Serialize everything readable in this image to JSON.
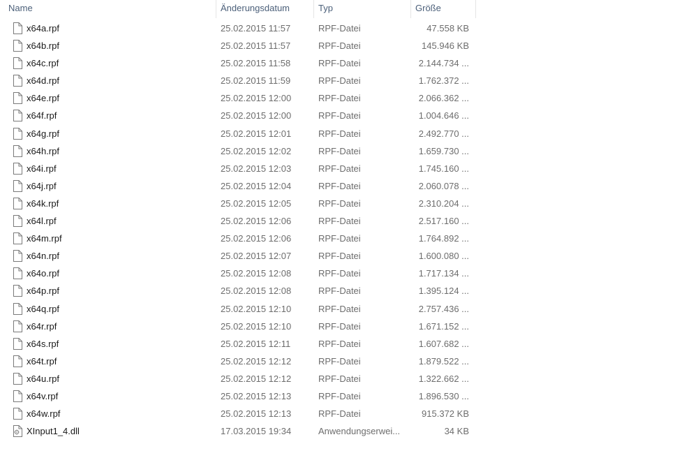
{
  "columns": {
    "name": "Name",
    "date": "Änderungsdatum",
    "type": "Typ",
    "size": "Größe"
  },
  "files": [
    {
      "name": "x64a.rpf",
      "date": "25.02.2015 11:57",
      "type": "RPF-Datei",
      "size": "47.558 KB",
      "icon": "file-icon"
    },
    {
      "name": "x64b.rpf",
      "date": "25.02.2015 11:57",
      "type": "RPF-Datei",
      "size": "145.946 KB",
      "icon": "file-icon"
    },
    {
      "name": "x64c.rpf",
      "date": "25.02.2015 11:58",
      "type": "RPF-Datei",
      "size": "2.144.734 ...",
      "icon": "file-icon"
    },
    {
      "name": "x64d.rpf",
      "date": "25.02.2015 11:59",
      "type": "RPF-Datei",
      "size": "1.762.372 ...",
      "icon": "file-icon"
    },
    {
      "name": "x64e.rpf",
      "date": "25.02.2015 12:00",
      "type": "RPF-Datei",
      "size": "2.066.362 ...",
      "icon": "file-icon"
    },
    {
      "name": "x64f.rpf",
      "date": "25.02.2015 12:00",
      "type": "RPF-Datei",
      "size": "1.004.646 ...",
      "icon": "file-icon"
    },
    {
      "name": "x64g.rpf",
      "date": "25.02.2015 12:01",
      "type": "RPF-Datei",
      "size": "2.492.770 ...",
      "icon": "file-icon"
    },
    {
      "name": "x64h.rpf",
      "date": "25.02.2015 12:02",
      "type": "RPF-Datei",
      "size": "1.659.730 ...",
      "icon": "file-icon"
    },
    {
      "name": "x64i.rpf",
      "date": "25.02.2015 12:03",
      "type": "RPF-Datei",
      "size": "1.745.160 ...",
      "icon": "file-icon"
    },
    {
      "name": "x64j.rpf",
      "date": "25.02.2015 12:04",
      "type": "RPF-Datei",
      "size": "2.060.078 ...",
      "icon": "file-icon"
    },
    {
      "name": "x64k.rpf",
      "date": "25.02.2015 12:05",
      "type": "RPF-Datei",
      "size": "2.310.204 ...",
      "icon": "file-icon"
    },
    {
      "name": "x64l.rpf",
      "date": "25.02.2015 12:06",
      "type": "RPF-Datei",
      "size": "2.517.160 ...",
      "icon": "file-icon"
    },
    {
      "name": "x64m.rpf",
      "date": "25.02.2015 12:06",
      "type": "RPF-Datei",
      "size": "1.764.892 ...",
      "icon": "file-icon"
    },
    {
      "name": "x64n.rpf",
      "date": "25.02.2015 12:07",
      "type": "RPF-Datei",
      "size": "1.600.080 ...",
      "icon": "file-icon"
    },
    {
      "name": "x64o.rpf",
      "date": "25.02.2015 12:08",
      "type": "RPF-Datei",
      "size": "1.717.134 ...",
      "icon": "file-icon"
    },
    {
      "name": "x64p.rpf",
      "date": "25.02.2015 12:08",
      "type": "RPF-Datei",
      "size": "1.395.124 ...",
      "icon": "file-icon"
    },
    {
      "name": "x64q.rpf",
      "date": "25.02.2015 12:10",
      "type": "RPF-Datei",
      "size": "2.757.436 ...",
      "icon": "file-icon"
    },
    {
      "name": "x64r.rpf",
      "date": "25.02.2015 12:10",
      "type": "RPF-Datei",
      "size": "1.671.152 ...",
      "icon": "file-icon"
    },
    {
      "name": "x64s.rpf",
      "date": "25.02.2015 12:11",
      "type": "RPF-Datei",
      "size": "1.607.682 ...",
      "icon": "file-icon"
    },
    {
      "name": "x64t.rpf",
      "date": "25.02.2015 12:12",
      "type": "RPF-Datei",
      "size": "1.879.522 ...",
      "icon": "file-icon"
    },
    {
      "name": "x64u.rpf",
      "date": "25.02.2015 12:12",
      "type": "RPF-Datei",
      "size": "1.322.662 ...",
      "icon": "file-icon"
    },
    {
      "name": "x64v.rpf",
      "date": "25.02.2015 12:13",
      "type": "RPF-Datei",
      "size": "1.896.530 ...",
      "icon": "file-icon"
    },
    {
      "name": "x64w.rpf",
      "date": "25.02.2015 12:13",
      "type": "RPF-Datei",
      "size": "915.372 KB",
      "icon": "file-icon"
    },
    {
      "name": "XInput1_4.dll",
      "date": "17.03.2015 19:34",
      "type": "Anwendungserwei...",
      "size": "34 KB",
      "icon": "dll-file-icon"
    }
  ],
  "colors": {
    "header_text": "#4c607a",
    "detail_text": "#6d6d6d",
    "name_text": "#1a1a1a",
    "separator": "#e5e5e5"
  }
}
